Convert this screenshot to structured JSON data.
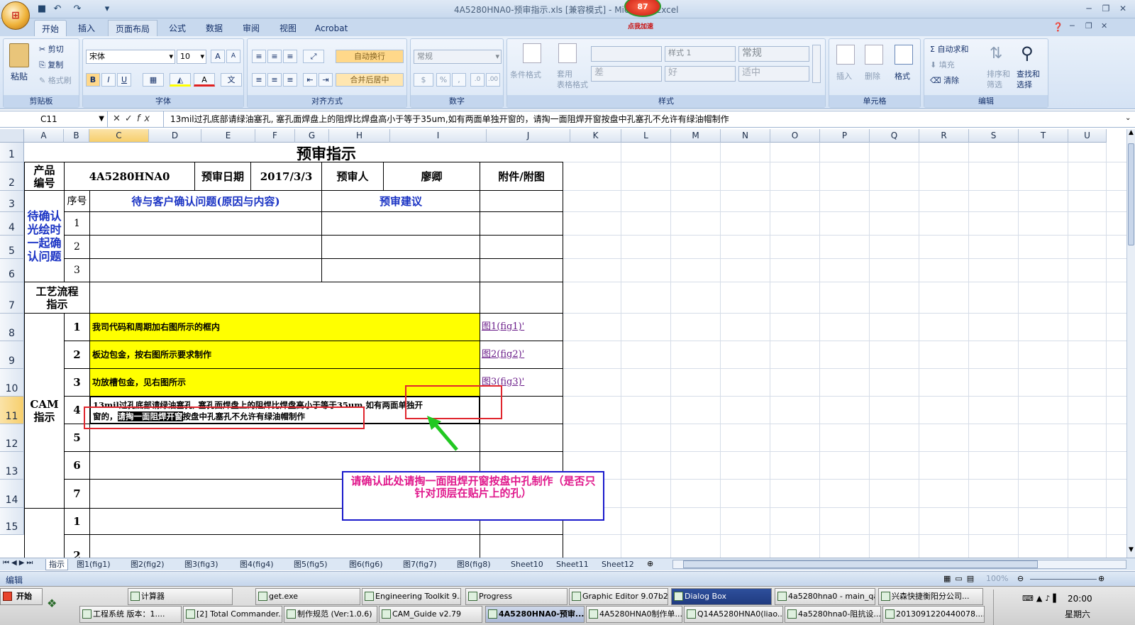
{
  "window": {
    "title": "4A5280HNA0-预审指示.xls  [兼容模式] - Microsoft Excel",
    "badge_number": "87",
    "badge_label": "点我加速"
  },
  "tabs": [
    "开始",
    "插入",
    "页面布局",
    "公式",
    "数据",
    "审阅",
    "视图",
    "Acrobat"
  ],
  "ribbon": {
    "clipboard": {
      "paste": "粘贴",
      "cut": "剪切",
      "copy": "复制",
      "format_painter": "格式刷",
      "label": "剪贴板"
    },
    "font": {
      "name": "宋体",
      "size": "10",
      "label": "字体"
    },
    "alignment": {
      "wrap": "自动换行",
      "merge": "合并后居中",
      "label": "对齐方式"
    },
    "number": {
      "format": "常规",
      "label": "数字"
    },
    "styles": {
      "cond": "条件格式",
      "table": "套用\n表格格式",
      "style1": "样式 1",
      "normal": "常规",
      "bad": "差",
      "good": "好",
      "neutral": "适中",
      "label": "样式"
    },
    "cells": {
      "insert": "插入",
      "delete": "删除",
      "format": "格式",
      "label": "单元格"
    },
    "editing": {
      "autosum": "自动求和",
      "fill": "填充",
      "clear": "清除",
      "sort": "排序和\n筛选",
      "find": "查找和\n选择",
      "label": "编辑"
    }
  },
  "formula_bar": {
    "name_box": "C11",
    "formula": "13mil过孔底部请绿油塞孔, 塞孔面焊盘上的阻焊比焊盘高小于等于35um,如有两面单独开窗的，请掏一面阻焊开窗按盘中孔塞孔不允许有绿油帽制作"
  },
  "columns": [
    "A",
    "B",
    "C",
    "D",
    "E",
    "F",
    "G",
    "H",
    "I",
    "J",
    "K",
    "L",
    "M",
    "N",
    "O",
    "P",
    "Q",
    "R",
    "S",
    "T",
    "U"
  ],
  "rows": [
    "1",
    "2",
    "3",
    "4",
    "5",
    "6",
    "7",
    "8",
    "9",
    "10",
    "11",
    "12",
    "13",
    "14",
    "15"
  ],
  "sheet": {
    "title": "预审指示",
    "product_label": "产品\n编号",
    "product_value": "4A5280HNA0",
    "date_label": "预审日期",
    "date_value": "2017/3/3",
    "reviewer_label": "预审人",
    "reviewer_value": "廖卿",
    "attachment_label": "附件/附图",
    "seq_label": "序号",
    "issue_header": "待与客户确认问题(原因与内容)",
    "suggestion_header": "预审建议",
    "confirm_group": "待确认\n光绘时\n一起确\n认问题",
    "confirm_seq": [
      "1",
      "2",
      "3"
    ],
    "process_label": "工艺流程\n指示",
    "cam_label": "CAM\n指示",
    "cam_seq": [
      "1",
      "2",
      "3",
      "4",
      "5",
      "6",
      "7"
    ],
    "cam_items": [
      "我司代码和周期加右图所示的框内",
      "板边包金，按右图所示要求制作",
      "功放槽包金，见右图所示"
    ],
    "cam_item4_line1": "13mil过孔底部请绿油塞孔, 塞孔面焊盘上的阻焊比焊盘高小于等于35um,如有两面单独开",
    "cam_item4_line2a": "窗的，",
    "cam_item4_highlight": "请掏一面阻焊开窗",
    "cam_item4_line2b": "按盘中孔塞孔不允许有绿油帽制作",
    "links": [
      "图1(fig1)'",
      "图2(fig2)'",
      "图3(fig3)'"
    ],
    "next_seq": [
      "1",
      "2"
    ],
    "note": "请确认此处请掏一面阻焊开窗按盘中孔制作（是否只针对顶层在贴片上的孔）"
  },
  "sheet_tabs": [
    "指示",
    "图1(fig1)",
    "图2(fig2)",
    "图3(fig3)",
    "图4(fig4)",
    "图5(fig5)",
    "图6(fig6)",
    "图7(fig7)",
    "图8(fig8)",
    "Sheet10",
    "Sheet11",
    "Sheet12"
  ],
  "status": {
    "mode": "编辑",
    "zoom": "100%"
  },
  "taskbar": {
    "start": "开始",
    "row1": [
      "计算器",
      "get.exe",
      "Engineering Toolkit 9....",
      "Progress",
      "Graphic Editor 9.07b2 ...",
      "Dialog Box",
      "4a5280hna0 - main_qa",
      "兴森快捷衡阳分公司..."
    ],
    "row2": [
      "工程系统  版本：1....",
      "[2] Total Commander...",
      "制作规范 (Ver:1.0.6)",
      "CAM_Guide v2.79",
      "4A5280HNA0-预审...",
      "4A5280HNA0制作单...",
      "Q14A5280HNA0(liao...",
      "4a5280hna0-阻抗设...",
      "2013091220440078...."
    ],
    "time": "20:00",
    "day": "星期六"
  },
  "colors": {
    "note_text": "#e0188c",
    "note_border": "#1a1acc",
    "red_box": "#e0262e",
    "yellow": "#ffff00",
    "blue_text": "#1a33c4",
    "link": "#6b1e8a",
    "arrow": "#22c822"
  }
}
